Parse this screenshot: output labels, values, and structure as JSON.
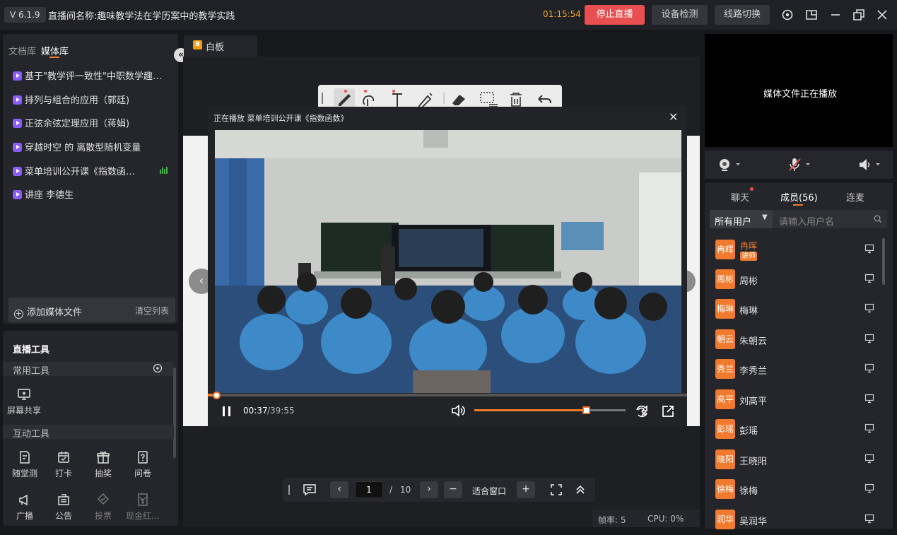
{
  "titlebar": {
    "version": "V 6.1.9",
    "room_title": "直播间名称:趣味教学法在学历案中的教学实践",
    "timer": "01:15:54",
    "stop_label": "停止直播",
    "device_check_label": "设备检测",
    "line_switch_label": "线路切换"
  },
  "media_library": {
    "tabs": [
      "文档库",
      "媒体库"
    ],
    "items": [
      "基于\"教学评一致性\"中职数学趣…",
      "排列与组合的应用（郭廷)",
      "正弦余弦定理应用（蒋娟)",
      "穿越时空 的 离散型随机变量",
      "菜单培训公开课《指数函…",
      "讲座 李德生"
    ],
    "add_label": "添加媒体文件",
    "clear_label": "清空列表"
  },
  "tools": {
    "title": "直播工具",
    "common_header": "常用工具",
    "screen_share": "屏幕共享",
    "interactive_header": "互动工具",
    "row1": [
      "随堂测",
      "打卡",
      "抽奖",
      "问卷"
    ],
    "row2": [
      "广播",
      "公告",
      "投票",
      "现金红…"
    ]
  },
  "whiteboard": {
    "tab_icon_letter": "B",
    "tab_label": "白板"
  },
  "player": {
    "title": "正在播放 菜单培训公开课《指数函数》",
    "current_time": "00:37",
    "total_time": "/39:55",
    "progress": 0.0154,
    "volume": 0.74
  },
  "pager": {
    "current_page": "1",
    "separator": "/",
    "total_pages": "10",
    "fit_label": "适合窗口"
  },
  "status": {
    "fps": "帧率: 5",
    "cpu": "CPU:  0%"
  },
  "preview": {
    "text": "媒体文件正在播放"
  },
  "members": {
    "tabs": {
      "chat": "聊天",
      "members": "成员(56)",
      "mic": "连麦"
    },
    "filter": "所有用户",
    "search_placeholder": "请输入用户名",
    "host": {
      "avatar": "冉晖",
      "name": "冉晖",
      "badge": "讲师"
    },
    "list": [
      {
        "avatar": "周彬",
        "name": "周彬"
      },
      {
        "avatar": "梅琳",
        "name": "梅琳"
      },
      {
        "avatar": "朝云",
        "name": "朱朝云"
      },
      {
        "avatar": "秀兰",
        "name": "李秀兰"
      },
      {
        "avatar": "高平",
        "name": "刘高平"
      },
      {
        "avatar": "彭瑶",
        "name": "彭瑶"
      },
      {
        "avatar": "晓阳",
        "name": "王晓阳"
      },
      {
        "avatar": "徐梅",
        "name": "徐梅"
      },
      {
        "avatar": "润华",
        "name": "吴润华"
      }
    ]
  },
  "colors": {
    "accent": "#f07a2e",
    "stop": "#e8504f",
    "media_icon": "#8b5cf6",
    "background": "#17181c"
  }
}
